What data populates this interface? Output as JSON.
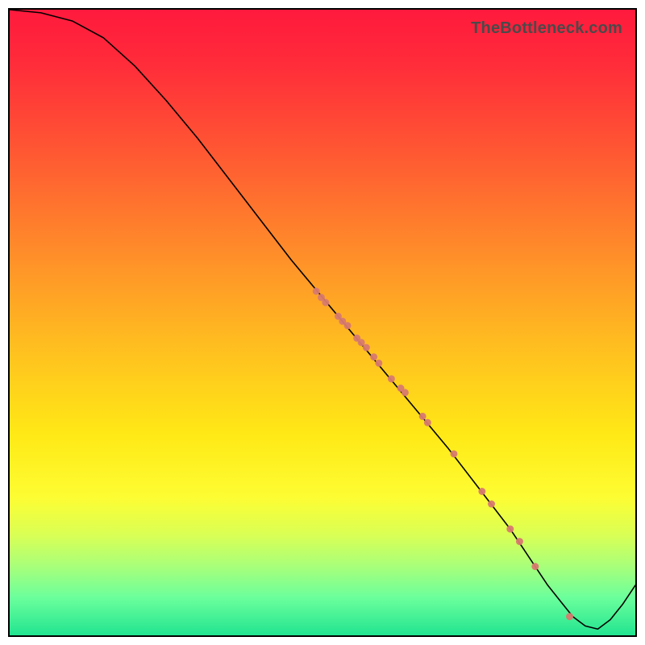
{
  "attribution": "TheBottleneck.com",
  "chart_data": {
    "type": "line",
    "title": "",
    "xlabel": "",
    "ylabel": "",
    "xlim": [
      0,
      100
    ],
    "ylim": [
      0,
      100
    ],
    "grid": false,
    "legend": false,
    "background": "rainbow-gradient-vertical",
    "series": [
      {
        "name": "bottleneck-curve",
        "x": [
          0,
          5,
          10,
          15,
          20,
          25,
          30,
          35,
          40,
          45,
          50,
          55,
          60,
          65,
          70,
          75,
          80,
          82,
          84,
          86,
          88,
          90,
          92,
          94,
          96,
          98,
          100
        ],
        "y": [
          100,
          99.5,
          98.2,
          95.5,
          91,
          85.5,
          79.5,
          73,
          66.5,
          60,
          54,
          48,
          42,
          36,
          30,
          23.5,
          17,
          14,
          11,
          8,
          5.5,
          3,
          1.5,
          1,
          2.5,
          5,
          8
        ]
      }
    ],
    "scatter_points": {
      "name": "highlighted-points-on-curve",
      "x": [
        49,
        49.8,
        50.5,
        52.5,
        53.2,
        54,
        55.5,
        56.2,
        57,
        58.2,
        59,
        61,
        62.5,
        63.2,
        66,
        66.8,
        71,
        75.5,
        77,
        80,
        81.5,
        84,
        89.5
      ],
      "y": [
        55,
        54,
        53.2,
        51,
        50.2,
        49.5,
        47.5,
        46.8,
        46,
        44.5,
        43.5,
        41,
        39.5,
        38.8,
        35,
        34,
        29,
        23,
        21,
        17,
        15,
        11,
        3
      ],
      "marker_size_approx_px": 9
    }
  }
}
